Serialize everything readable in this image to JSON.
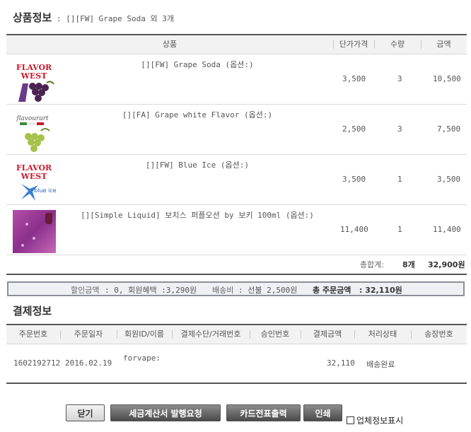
{
  "product_section": {
    "title": "상품정보",
    "subtitle": ": [][FW] Grape Soda 외 3개",
    "headers": {
      "product": "상품",
      "unit_price": "단가가격",
      "qty": "수량",
      "amount": "금액"
    },
    "items": [
      {
        "name": "[][FW] Grape Soda (옵션:)",
        "unit_price": "3,500",
        "qty": "3",
        "amount": "10,500",
        "thumb": "flavor-west-grape-soda"
      },
      {
        "name": "[][FA] Grape white Flavor (옵션:)",
        "unit_price": "2,500",
        "qty": "3",
        "amount": "7,500",
        "thumb": "flavour-art-white-grape"
      },
      {
        "name": "[][FW] Blue Ice (옵션:)",
        "unit_price": "3,500",
        "qty": "1",
        "amount": "3,500",
        "thumb": "flavor-west-blue-ice"
      },
      {
        "name": "[][Simple Liquid] 보치스 퍼플오션 by 보키 100ml (옵션:)",
        "unit_price": "11,400",
        "qty": "1",
        "amount": "11,400",
        "thumb": "purple-ocean-liquid"
      }
    ],
    "total_label": "총합계:",
    "total_count": "8개",
    "total_amount": "32,900원"
  },
  "discount_bar": {
    "discount_label": "할인금액",
    "discount_value": ": 0, 회원혜택 :3,290원",
    "shipping_label": "배송비",
    "shipping_value": ": 선불 2,500원",
    "order_total_label": "총 주문금액",
    "order_total_value": ": 32,110원"
  },
  "payment_section": {
    "title": "결제정보",
    "headers": [
      "주문번호",
      "주문일자",
      "회원ID/이름",
      "결제수단/거래번호",
      "승인번호",
      "결제금액",
      "처리상태",
      "송장번호"
    ],
    "row": {
      "order_no": "1602192712",
      "order_date": "2016.02.19",
      "member": "forvape:",
      "method": "",
      "approval": "",
      "amount": "32,110",
      "status": "배송완료",
      "invoice": ""
    }
  },
  "buttons": {
    "close": "닫기",
    "tax_invoice": "세금계산서 발행요청",
    "card_slip": "카드전표출력",
    "print": "인쇄"
  },
  "checkbox": {
    "label": "업체정보표시",
    "checked": false
  },
  "brand": {
    "fw_logo_line1": "FLAVOR",
    "fw_logo_line2": "WEST",
    "fa_logo": "flavourart",
    "blue_ice_text": "blue ice"
  },
  "colors": {
    "fw_red": "#c8192b",
    "grape_purple": "#5a2a55",
    "header_bg": "#f2f2f2",
    "dark_line": "#555555"
  }
}
